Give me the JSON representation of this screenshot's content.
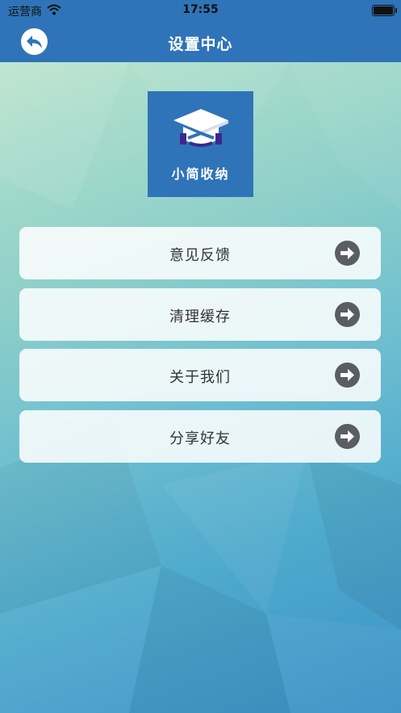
{
  "status_bar": {
    "carrier": "运营商",
    "time": "17:55"
  },
  "header": {
    "title": "设置中心",
    "back_icon": "back-arrow-icon"
  },
  "logo": {
    "text": "小简收纳",
    "icon": "graduation-cap-icon"
  },
  "menu": {
    "items": [
      {
        "label": "意见反馈",
        "icon": "arrow-right-circle-icon"
      },
      {
        "label": "清理缓存",
        "icon": "arrow-right-circle-icon"
      },
      {
        "label": "关于我们",
        "icon": "arrow-right-circle-icon"
      },
      {
        "label": "分享好友",
        "icon": "arrow-right-circle-icon"
      }
    ]
  },
  "colors": {
    "header_bg": "#2f74b8",
    "logo_bg": "#2f74b8",
    "arrow": "#5a5d63"
  }
}
